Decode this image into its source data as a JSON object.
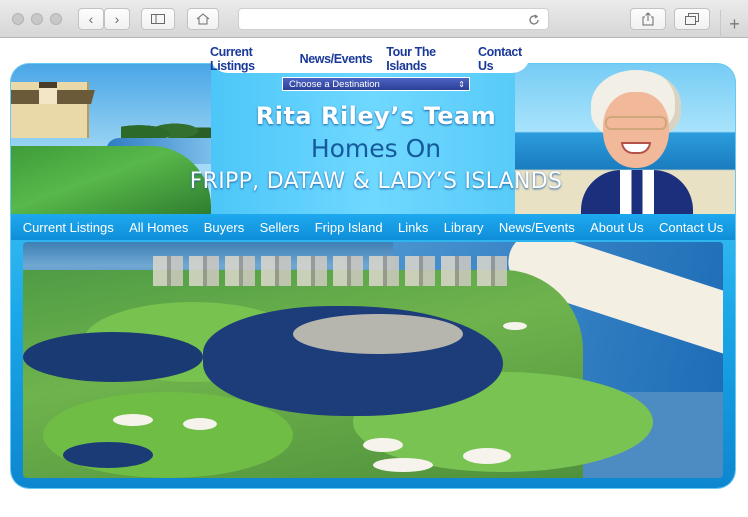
{
  "browser": {
    "nav_back": "‹",
    "nav_forward": "›",
    "sidebar_icon": "sidebar-icon",
    "home_icon": "home-icon",
    "reload_icon": "reload-icon",
    "share_icon": "share-icon",
    "tabs_icon": "tabs-icon",
    "new_tab": "+"
  },
  "top_nav": [
    "Current Listings",
    "News/Events",
    "Tour The Islands",
    "Contact Us"
  ],
  "destination": {
    "label": "Choose a Destination",
    "arrow": "⇕"
  },
  "header": {
    "line1": "Rita Riley’s Team",
    "line2": "Homes On",
    "line3": "FRIPP, DATAW & LADY’S ISLANDS"
  },
  "main_nav": [
    "Current Listings",
    "All Homes",
    "Buyers",
    "Sellers",
    "Fripp Island",
    "Links",
    "Library",
    "News/Events",
    "About Us",
    "Contact Us"
  ],
  "colors": {
    "frame_blue": "#1aa7e8",
    "nav_text": "#1a3a9a",
    "title_dark": "#155a9c"
  }
}
